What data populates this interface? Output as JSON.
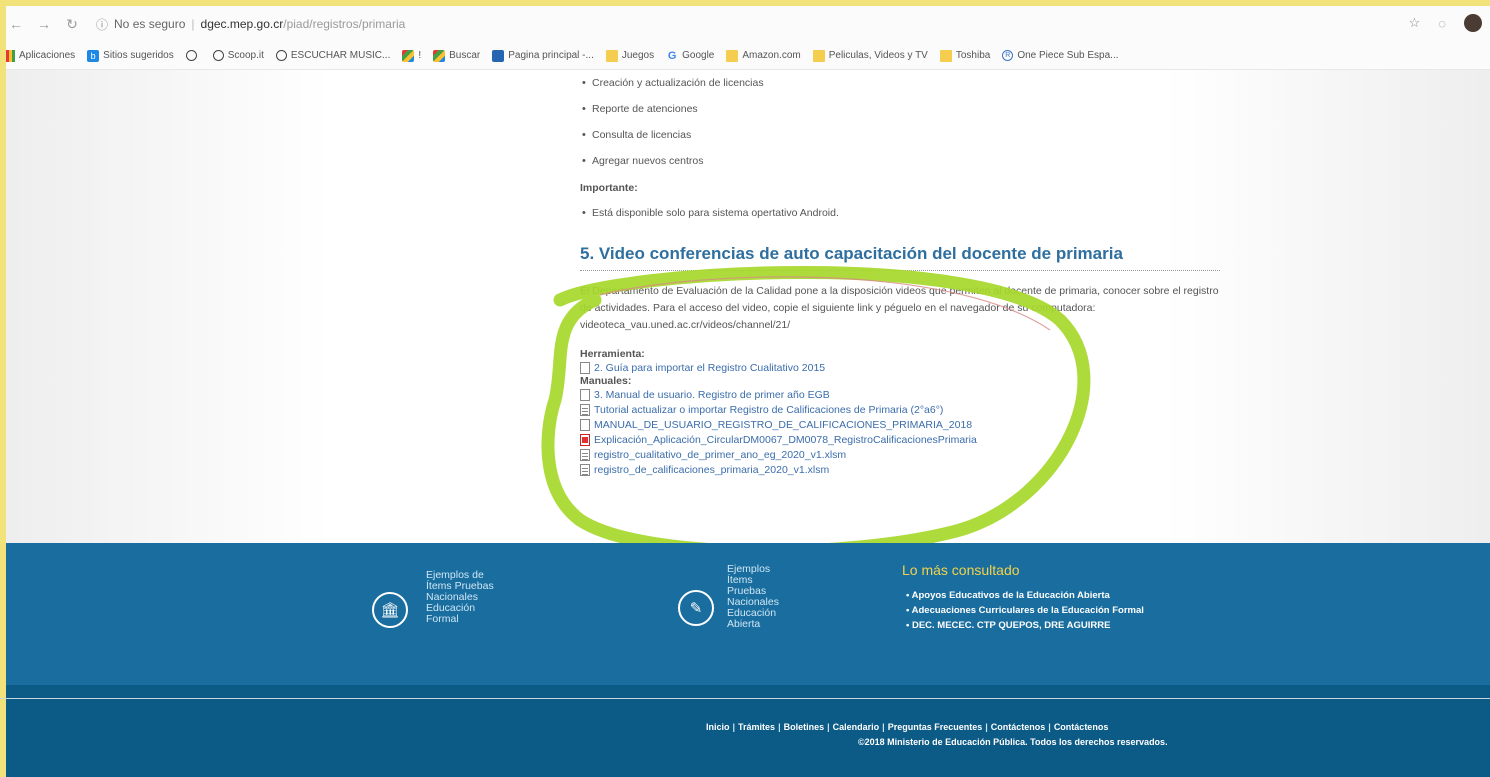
{
  "browser": {
    "security_label": "No es seguro",
    "url_host": "dgec.mep.go.cr",
    "url_path": "/piad/registros/primaria",
    "bookmarks": [
      {
        "label": "Aplicaciones",
        "icon": "apps-icon"
      },
      {
        "label": "Sitios sugeridos",
        "icon": "bing-icon"
      },
      {
        "label": "",
        "icon": "globe-icon"
      },
      {
        "label": "Scoop.it",
        "icon": "globe-icon"
      },
      {
        "label": "ESCUCHAR MUSIC...",
        "icon": "globe-icon"
      },
      {
        "label": "!",
        "icon": "multicolor-icon"
      },
      {
        "label": "Buscar",
        "icon": "bar-chart-icon"
      },
      {
        "label": "Pagina principal -...",
        "icon": "blue-square-icon"
      },
      {
        "label": "Juegos",
        "icon": "folder-icon"
      },
      {
        "label": "Google",
        "icon": "google-icon"
      },
      {
        "label": "Amazon.com",
        "icon": "folder-icon"
      },
      {
        "label": "Peliculas, Videos y TV",
        "icon": "folder-icon"
      },
      {
        "label": "Toshiba",
        "icon": "folder-icon"
      },
      {
        "label": "One Piece Sub Espa...",
        "icon": "circle-icon"
      }
    ]
  },
  "content": {
    "bullets": [
      "Creación y actualización de licencias",
      "Reporte de atenciones",
      "Consulta de licencias",
      "Agregar nuevos centros"
    ],
    "important_label": "Importante:",
    "important_item": "Está disponible solo para sistema opertativo Android.",
    "section_heading": "5. Video conferencias de auto capacitación del docente de primaria",
    "paragraph": "El Departamento de Evaluación de la Calidad pone a la disposición videos que permiten al docente de primaria, conocer sobre el registro de actividades. Para el acceso del video, copie el siguiente link y péguelo en el navegador de su computadora:  videoteca_vau.uned.ac.cr/videos/channel/21/",
    "herramienta_label": "Herramienta:",
    "herramienta_docs": [
      {
        "label": "2. Guía para importar el Registro Cualitativo 2015",
        "icon": "document-icon"
      }
    ],
    "manuales_label": "Manuales:",
    "manuales_docs": [
      {
        "label": "3. Manual de usuario. Registro de primer año EGB",
        "icon": "document-icon"
      },
      {
        "label": "Tutorial actualizar o importar Registro de Calificaciones de Primaria (2°a6°)",
        "icon": "spreadsheet-icon"
      },
      {
        "label": "MANUAL_DE_USUARIO_REGISTRO_DE_CALIFICACIONES_PRIMARIA_2018",
        "icon": "document-icon"
      },
      {
        "label": "Explicación_Aplicación_CircularDM0067_DM0078_RegistroCalificacionesPrimaria",
        "icon": "pdf-icon"
      },
      {
        "label": "registro_cualitativo_de_primer_ano_eg_2020_v1.xlsm",
        "icon": "spreadsheet-icon"
      },
      {
        "label": "registro_de_calificaciones_primaria_2020_v1.xlsm",
        "icon": "spreadsheet-icon"
      }
    ]
  },
  "footer": {
    "item1": [
      "Ejemplos de",
      "Ítems Pruebas",
      "Nacionales",
      "Educación",
      "Formal"
    ],
    "item2": [
      "Ejemplos",
      "Ítems",
      "Pruebas",
      "Nacionales",
      "Educación",
      "Abierta"
    ],
    "consult_title": "Lo más consultado",
    "consult_items": [
      "Apoyos Educativos de la Educación Abierta",
      "Adecuaciones Curriculares de la Educación Formal",
      "DEC. MECEC. CTP QUEPOS, DRE AGUIRRE"
    ],
    "nav": [
      "Inicio",
      "Trámites",
      "Boletines",
      "Calendario",
      "Preguntas Frecuentes",
      "Contáctenos",
      "Contáctenos"
    ],
    "copyright": "©2018 Ministerio de Educación Pública. Todos los derechos reservados."
  },
  "colors": {
    "heading": "#2f6f9f",
    "link": "#3b6dab",
    "footer_main": "#1a6e9f",
    "footer_bottom": "#0c5a86",
    "consult_title": "#f2d24a",
    "marker": "#a6d82a"
  }
}
